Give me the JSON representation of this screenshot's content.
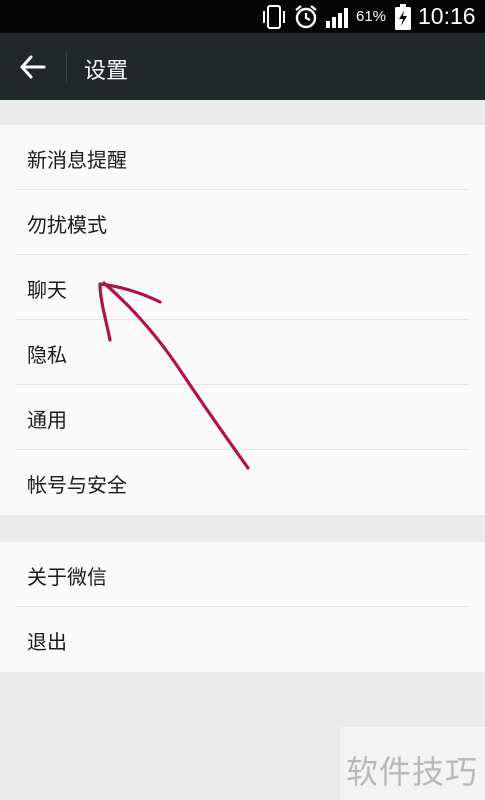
{
  "status_bar": {
    "battery_percent": "61%",
    "time": "10:16",
    "icons": [
      "vibrate-icon",
      "alarm-clock-icon",
      "signal-icon",
      "battery-charging-icon"
    ]
  },
  "header": {
    "title": "设置",
    "back_icon": "arrow-left-icon"
  },
  "groups": [
    {
      "items": [
        {
          "label": "新消息提醒"
        },
        {
          "label": "勿扰模式"
        },
        {
          "label": "聊天"
        },
        {
          "label": "隐私"
        },
        {
          "label": "通用"
        },
        {
          "label": "帐号与安全"
        }
      ]
    },
    {
      "items": [
        {
          "label": "关于微信"
        },
        {
          "label": "退出"
        }
      ]
    }
  ],
  "annotation": {
    "type": "hand-drawn-arrow",
    "color": "#b0124a",
    "points_to": "聊天"
  },
  "watermark": {
    "text": "软件技巧"
  },
  "colors": {
    "status_bar_bg": "#050505",
    "header_bg": "#21282a",
    "page_bg": "#ebebeb",
    "item_bg": "#fafafa",
    "divider": "#e4e4e4",
    "annotation": "#b0124a"
  }
}
